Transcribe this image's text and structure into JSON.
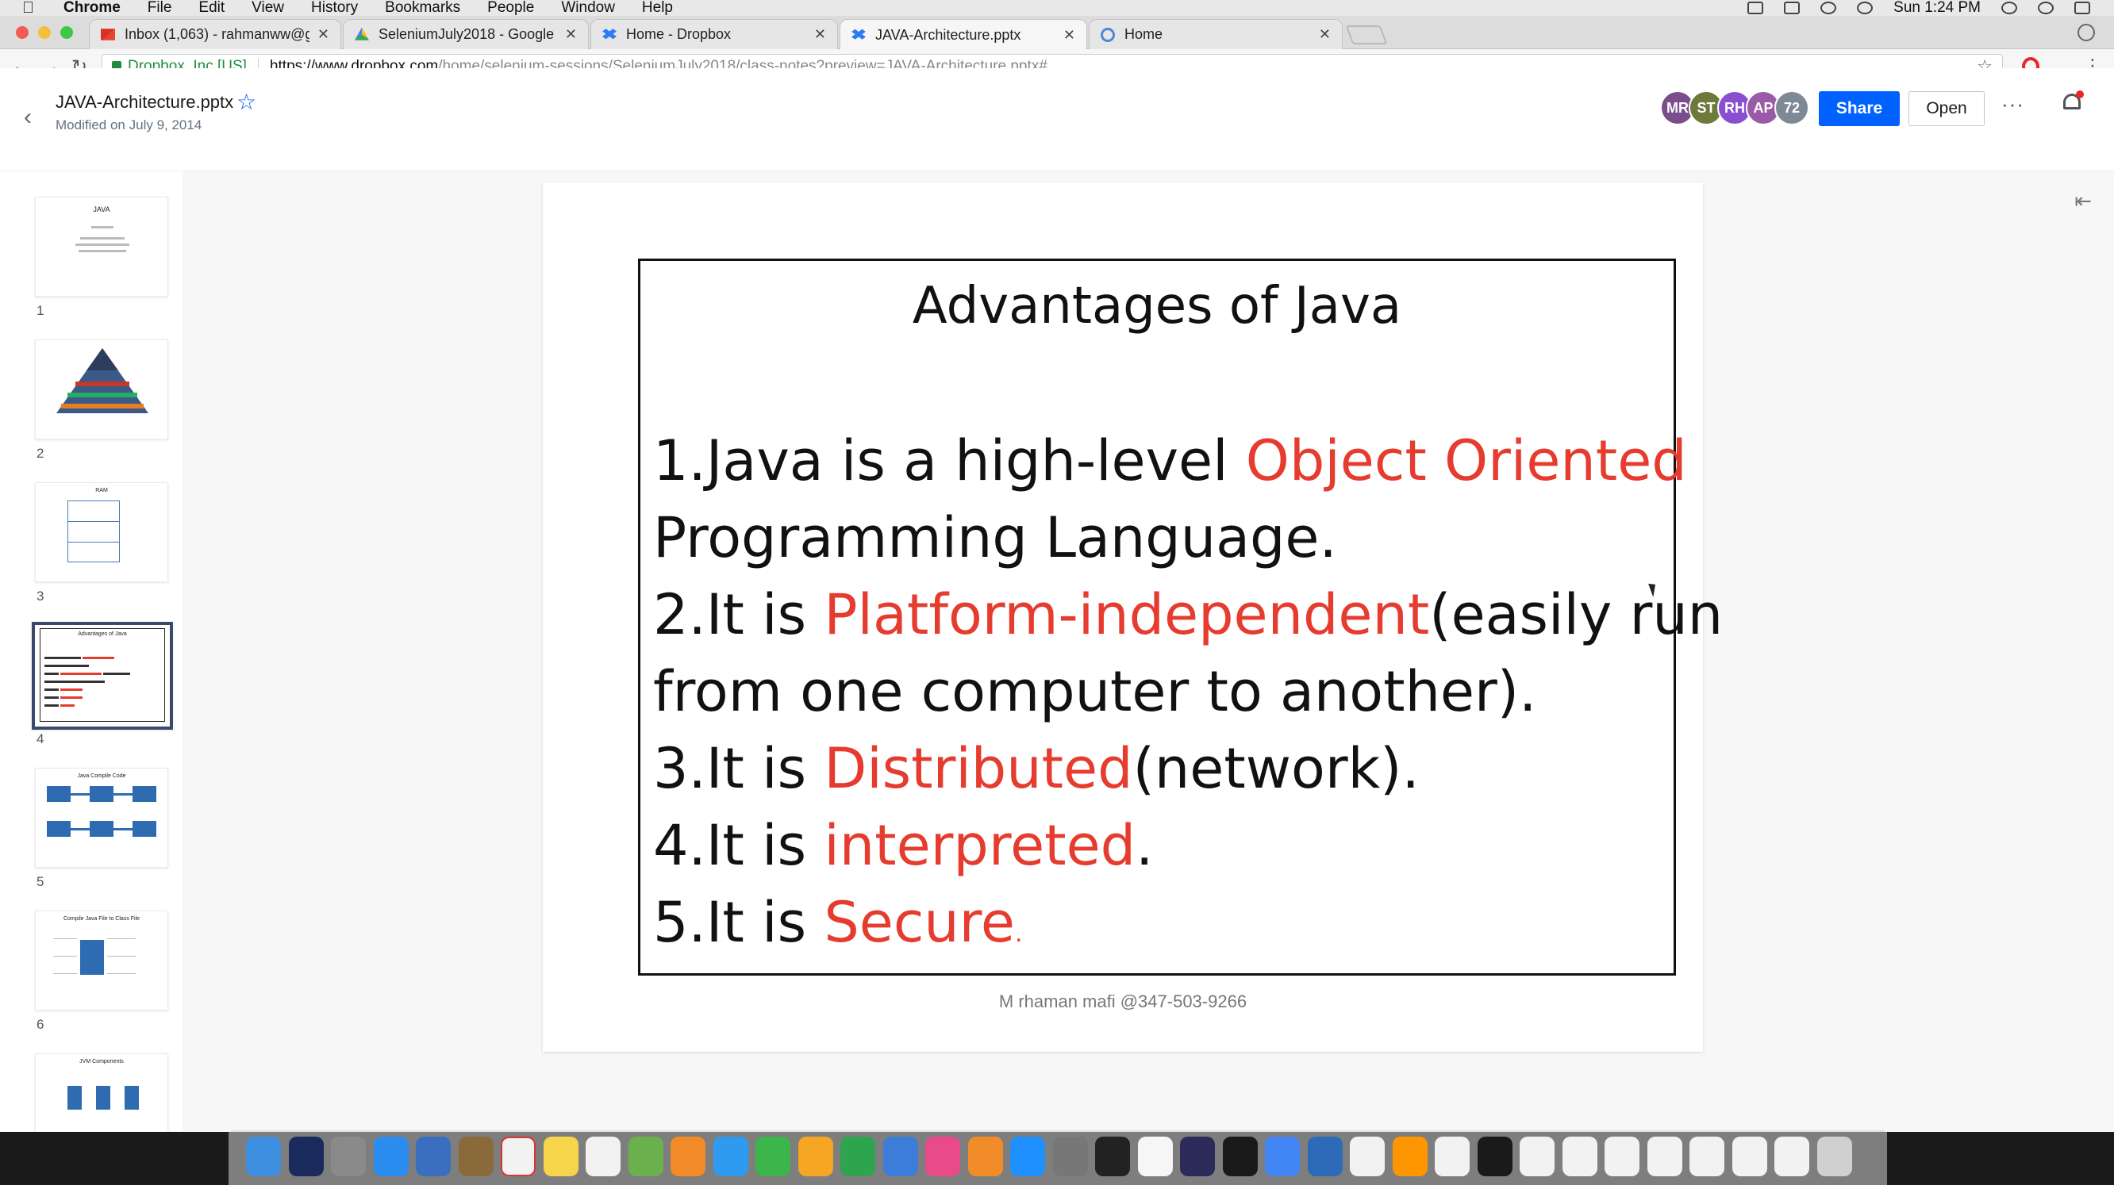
{
  "menubar": {
    "app": "Chrome",
    "menus": [
      "File",
      "Edit",
      "View",
      "History",
      "Bookmarks",
      "People",
      "Window",
      "Help"
    ],
    "clock": "Sun 1:24 PM"
  },
  "tabs": [
    {
      "title": "Inbox (1,063) - rahmanww@gr",
      "icon": "gmail-icon"
    },
    {
      "title": "SeleniumJuly2018 - Google Dr",
      "icon": "google-drive-icon"
    },
    {
      "title": "Home - Dropbox",
      "icon": "dropbox-icon"
    },
    {
      "title": "JAVA-Architecture.pptx",
      "icon": "dropbox-icon"
    },
    {
      "title": "Home",
      "icon": "home-page-icon"
    }
  ],
  "address": {
    "org": "Dropbox, Inc [US]",
    "url_host": "https://www.dropbox.com",
    "url_path": "/home/selenium-sessions/SeleniumJuly2018/class-notes?preview=JAVA-Architecture.pptx#"
  },
  "file": {
    "name": "JAVA-Architecture.pptx",
    "modified": "Modified on July 9, 2014"
  },
  "avatars": [
    {
      "initials": "MR",
      "color": "#7a4e8c"
    },
    {
      "initials": "ST",
      "color": "#6d7a3a"
    },
    {
      "initials": "RH",
      "color": "#8a4fd0"
    },
    {
      "initials": "AP",
      "color": "#9a5aa8"
    },
    {
      "initials": "72",
      "color": "#7d8a96"
    }
  ],
  "buttons": {
    "share": "Share",
    "open": "Open",
    "more": "···"
  },
  "thumbnails": [
    {
      "num": "1",
      "title": "JAVA"
    },
    {
      "num": "2",
      "title": ""
    },
    {
      "num": "3",
      "title": "RAM"
    },
    {
      "num": "4",
      "title": "Advantages of Java"
    },
    {
      "num": "5",
      "title": "Java Compile Code"
    },
    {
      "num": "6",
      "title": "Compile Java File to Class File"
    },
    {
      "num": "",
      "title": "JVM Components"
    }
  ],
  "slide": {
    "title": "Advantages of Java",
    "l1a": "1.Java is a high-level ",
    "l1b": "Object Oriented",
    "l2": "Programming Language.",
    "l3a": "2.It is ",
    "l3b": "Platform-independent",
    "l3c": "(easily run",
    "l4": "from one computer to another).",
    "l5a": "3.It is ",
    "l5b": "Distributed",
    "l5c": "(network).",
    "l6a": "4.It is ",
    "l6b": "interpreted",
    "l6c": ".",
    "l7a": "5.It is ",
    "l7b": "Secure",
    "l7c": ".",
    "footer": "M rhaman  mafi  @347-503-9266"
  },
  "dock_apps": [
    "finder",
    "siri",
    "launchpad",
    "safari",
    "preview",
    "notes",
    "calendar",
    "stickies",
    "reminders",
    "maps",
    "photos",
    "messages",
    "facetime",
    "pages",
    "numbers",
    "keynote",
    "itunes",
    "ibooks",
    "app-store",
    "system-preferences",
    "terminal",
    "textedit",
    "eclipse",
    "bbedit",
    "chrome",
    "remote-desktop",
    "settings",
    "sublime",
    "settings-2",
    "activity-monitor",
    "file",
    "document",
    "window",
    "window-2",
    "window-3",
    "window-4",
    "window-5",
    "trash"
  ],
  "colors": {
    "dropbox_blue": "#0061fe",
    "slide_red": "#e63c2f"
  }
}
